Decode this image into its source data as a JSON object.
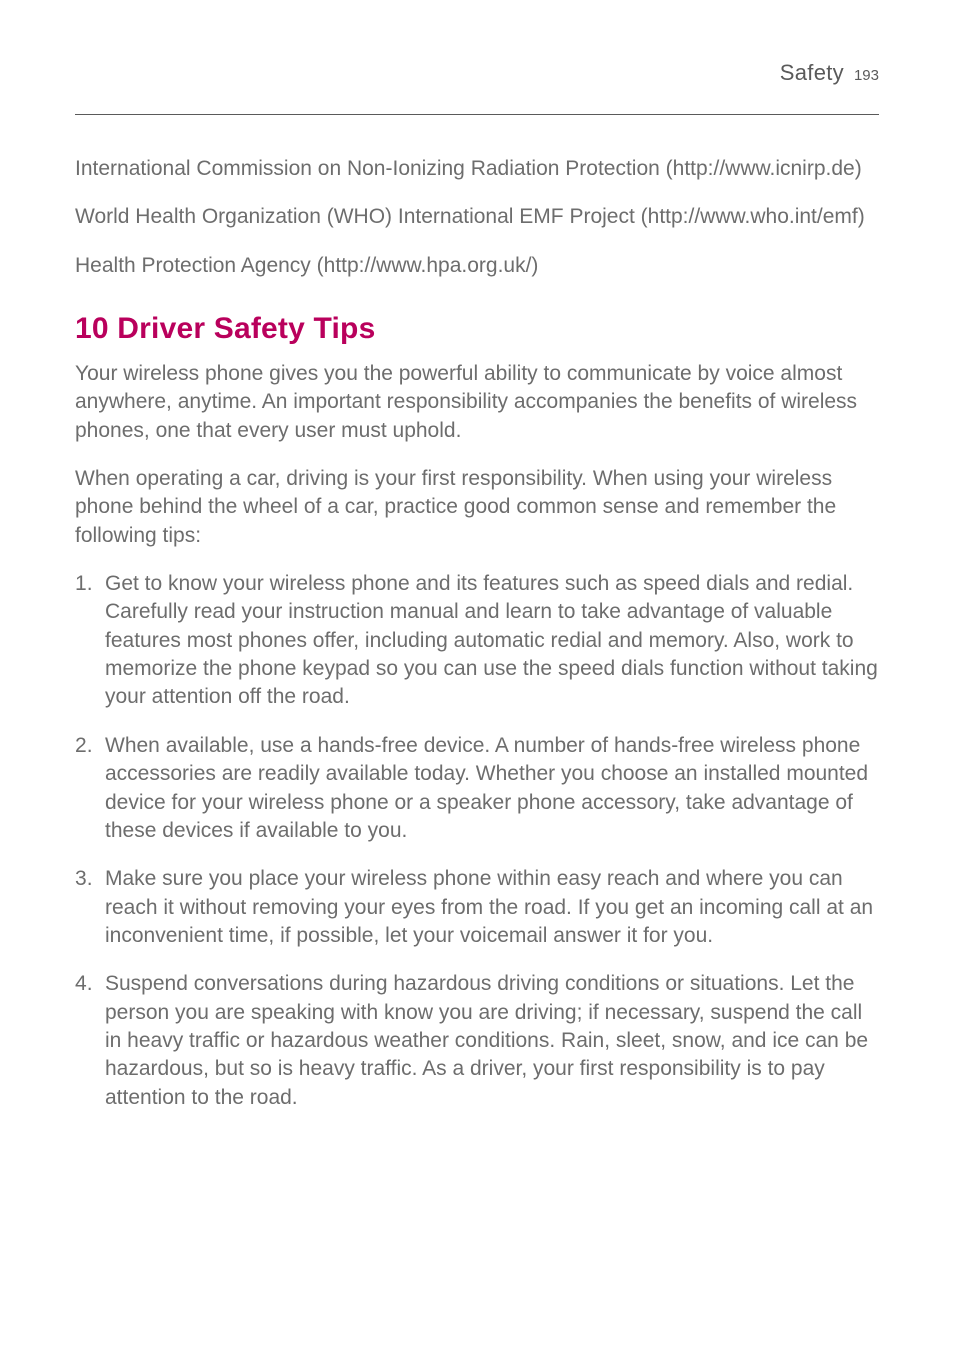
{
  "header": {
    "section": "Safety",
    "page_number": "193"
  },
  "intro_paragraphs": [
    "International Commission on Non-Ionizing Radiation Protection (http://www.icnirp.de)",
    "World Health Organization (WHO) International EMF Project (http://www.who.int/emf)",
    "Health Protection Agency (http://www.hpa.org.uk/)"
  ],
  "section": {
    "title": "10 Driver Safety Tips",
    "lead_paragraphs": [
      "Your wireless phone gives you the powerful ability to communicate by voice almost anywhere, anytime. An important responsibility accompanies the benefits of wireless phones, one that every user must uphold.",
      "When operating a car, driving is your first responsibility. When using your wireless phone behind the wheel of a car, practice good common sense and remember the following tips:"
    ],
    "tips": [
      "Get to know your wireless phone and its features such as speed dials and redial. Carefully read your instruction manual and learn to take advantage of valuable features most phones offer, including automatic redial and memory. Also, work to memorize the phone keypad so you can use the speed dials function without taking your attention off the road.",
      "When available, use a hands-free device. A number of hands-free wireless phone accessories are readily available today. Whether you choose an installed mounted device for your wireless phone or a speaker phone accessory, take advantage of these devices if available to you.",
      "Make sure you place your wireless phone within easy reach and where you can reach it without removing your eyes from the road. If you get an incoming call at an inconvenient time, if possible, let your voicemail answer it for you.",
      "Suspend conversations during hazardous driving conditions or situations. Let the person you are speaking with know you are driving; if necessary, suspend the call in heavy traffic or hazardous weather conditions. Rain, sleet, snow, and ice can be hazardous, but so is heavy traffic. As a driver, your first responsibility is to pay attention to the road."
    ]
  }
}
